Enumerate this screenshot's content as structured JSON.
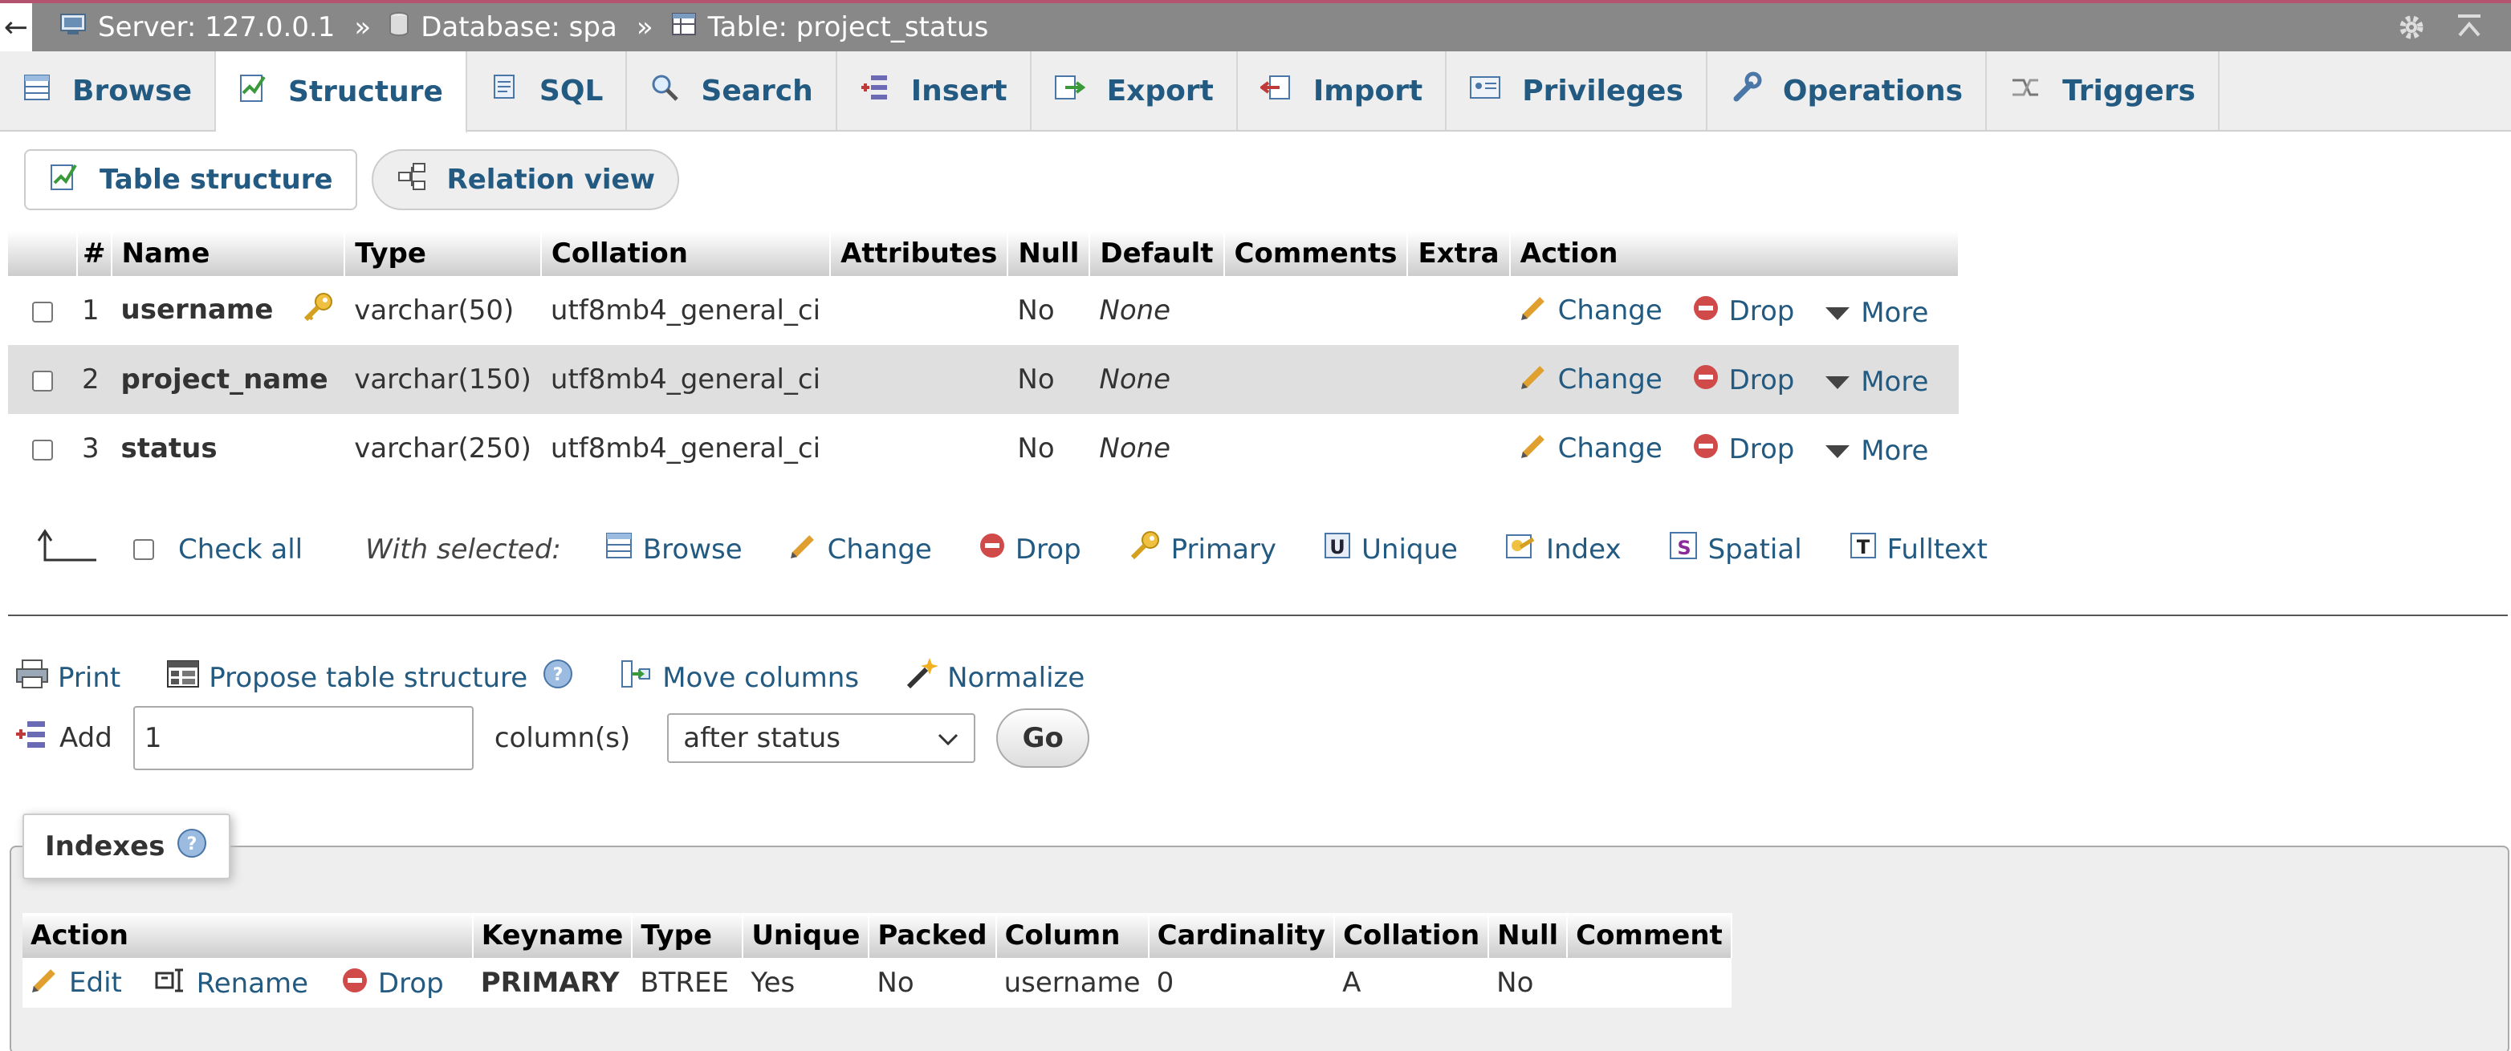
{
  "breadcrumb": {
    "back": "←",
    "server": "Server: 127.0.0.1",
    "database": "Database: spa",
    "table": "Table: project_status",
    "separator": "»"
  },
  "tabs": [
    {
      "label": "Browse",
      "icon": "browse-icon"
    },
    {
      "label": "Structure",
      "icon": "structure-icon",
      "active": true
    },
    {
      "label": "SQL",
      "icon": "sql-icon"
    },
    {
      "label": "Search",
      "icon": "search-icon"
    },
    {
      "label": "Insert",
      "icon": "insert-icon"
    },
    {
      "label": "Export",
      "icon": "export-icon"
    },
    {
      "label": "Import",
      "icon": "import-icon"
    },
    {
      "label": "Privileges",
      "icon": "privileges-icon"
    },
    {
      "label": "Operations",
      "icon": "operations-icon"
    },
    {
      "label": "Triggers",
      "icon": "triggers-icon"
    }
  ],
  "subtabs": {
    "table_structure": "Table structure",
    "relation_view": "Relation view"
  },
  "structure": {
    "headers": [
      "#",
      "Name",
      "Type",
      "Collation",
      "Attributes",
      "Null",
      "Default",
      "Comments",
      "Extra",
      "Action"
    ],
    "rows": [
      {
        "num": "1",
        "name": "username",
        "type": "varchar(50)",
        "collation": "utf8mb4_general_ci",
        "attributes": "",
        "null": "No",
        "default": "None",
        "comments": "",
        "extra": ""
      },
      {
        "num": "2",
        "name": "project_name",
        "type": "varchar(150)",
        "collation": "utf8mb4_general_ci",
        "attributes": "",
        "null": "No",
        "default": "None",
        "comments": "",
        "extra": ""
      },
      {
        "num": "3",
        "name": "status",
        "type": "varchar(250)",
        "collation": "utf8mb4_general_ci",
        "attributes": "",
        "null": "No",
        "default": "None",
        "comments": "",
        "extra": ""
      }
    ],
    "actions": {
      "change": "Change",
      "drop": "Drop",
      "more": "More"
    }
  },
  "bulk": {
    "check_all": "Check all",
    "with_selected": "With selected:",
    "actions": [
      "Browse",
      "Change",
      "Drop",
      "Primary",
      "Unique",
      "Index",
      "Spatial",
      "Fulltext"
    ]
  },
  "tools": {
    "print": "Print",
    "propose": "Propose table structure",
    "move": "Move columns",
    "normalize": "Normalize"
  },
  "add": {
    "label": "Add",
    "value": "1",
    "unit": "column(s)",
    "position": "after status",
    "go": "Go"
  },
  "indexes": {
    "legend": "Indexes",
    "headers": [
      "Action",
      "Keyname",
      "Type",
      "Unique",
      "Packed",
      "Column",
      "Cardinality",
      "Collation",
      "Null",
      "Comment"
    ],
    "row": {
      "edit": "Edit",
      "rename": "Rename",
      "drop": "Drop",
      "keyname": "PRIMARY",
      "type": "BTREE",
      "unique": "Yes",
      "packed": "No",
      "column": "username",
      "cardinality": "0",
      "collation": "A",
      "null": "No",
      "comment": ""
    }
  },
  "colors": {
    "link": "#235a81",
    "top_bar": "#888888",
    "accent": "#b4536f"
  }
}
